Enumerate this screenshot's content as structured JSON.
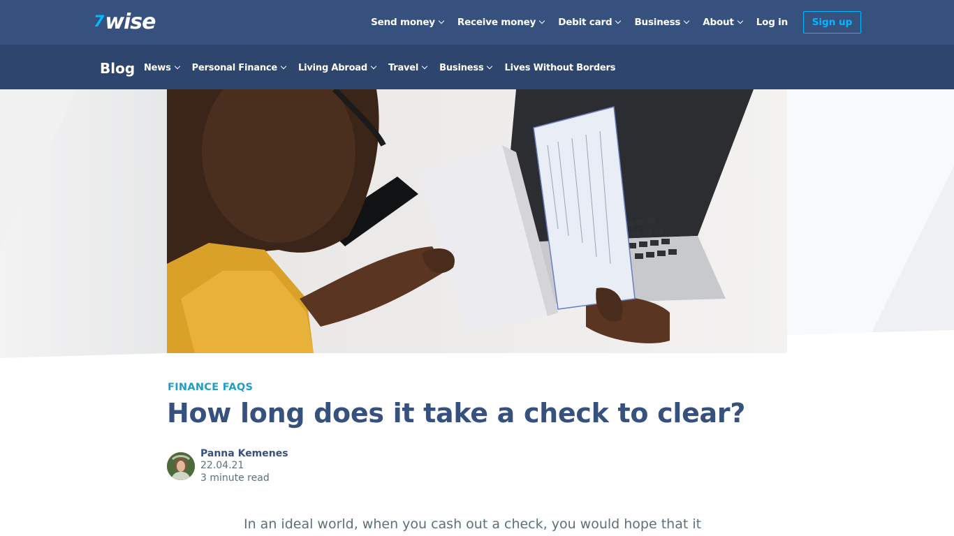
{
  "header": {
    "logo_text": "wise",
    "logo_flag": "7",
    "nav": [
      {
        "label": "Send money",
        "dropdown": true
      },
      {
        "label": "Receive money",
        "dropdown": true
      },
      {
        "label": "Debit card",
        "dropdown": true
      },
      {
        "label": "Business",
        "dropdown": true
      },
      {
        "label": "About",
        "dropdown": true
      }
    ],
    "login_label": "Log in",
    "signup_label": "Sign up"
  },
  "blog_nav": {
    "title": "Blog",
    "items": [
      {
        "label": "News",
        "dropdown": true
      },
      {
        "label": "Personal Finance",
        "dropdown": true
      },
      {
        "label": "Living Abroad",
        "dropdown": true
      },
      {
        "label": "Travel",
        "dropdown": true
      },
      {
        "label": "Business",
        "dropdown": true
      },
      {
        "label": "Lives Without Borders",
        "dropdown": false
      }
    ]
  },
  "hero": {
    "image_description": "Person holding an envelope and a check in front of a laptop and phone"
  },
  "article": {
    "category": "FINANCE FAQS",
    "title": "How long does it take a check to clear?",
    "author": "Panna Kemenes",
    "date": "22.04.21",
    "read_time": "3 minute read",
    "intro": "In an ideal world, when you cash out a check, you would hope that it"
  },
  "colors": {
    "header_bg": "#37517e",
    "blognav_bg": "#2e456e",
    "accent": "#00b9ff",
    "category": "#1c9ec8",
    "title": "#37517e",
    "body_text": "#5d7079"
  }
}
